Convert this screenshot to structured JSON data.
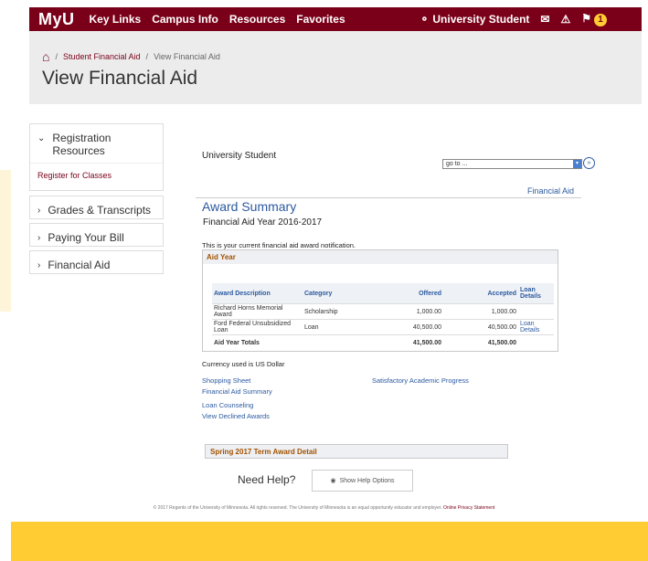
{
  "topnav": {
    "logo": "MyU",
    "items": [
      "Key Links",
      "Campus Info",
      "Resources",
      "Favorites"
    ],
    "user": "University Student",
    "notification_count": "1"
  },
  "breadcrumb": {
    "link": "Student Financial Aid",
    "current": "View Financial Aid"
  },
  "page_title": "View Financial Aid",
  "sidebar": {
    "registration": {
      "label": "Registration Resources",
      "link": "Register for Classes"
    },
    "items": [
      "Grades & Transcripts",
      "Paying Your Bill",
      "Financial Aid"
    ]
  },
  "main": {
    "student_name": "University Student",
    "goto_placeholder": "go to ...",
    "financial_aid_link": "Financial Aid",
    "award_summary_title": "Award Summary",
    "aid_year_label": "Financial Aid Year 2016-2017",
    "notification_text": "This is your current financial aid award notification.",
    "aid_year_header": "Aid Year",
    "table_headers": [
      "Award Description",
      "Category",
      "Offered",
      "Accepted",
      "Loan Details"
    ],
    "rows": [
      {
        "desc": "Richard Horns Memorial Award",
        "category": "Scholarship",
        "offered": "1,000.00",
        "accepted": "1,000.00",
        "loan": ""
      },
      {
        "desc": "Ford Federal Unsubsidized Loan",
        "category": "Loan",
        "offered": "40,500.00",
        "accepted": "40,500.00",
        "loan": "Loan Details"
      }
    ],
    "totals": {
      "label": "Aid Year Totals",
      "offered": "41,500.00",
      "accepted": "41,500.00"
    },
    "currency_note": "Currency used is US Dollar",
    "links": {
      "shopping_sheet": "Shopping Sheet",
      "fa_summary": "Financial Aid Summary",
      "sap": "Satisfactory Academic Progress",
      "loan_counseling": "Loan Counseling",
      "declined_awards": "View Declined Awards"
    },
    "term_header": "Spring 2017 Term Award Detail"
  },
  "help": {
    "title": "Need Help?",
    "button": "Show Help Options"
  },
  "footer": {
    "text": "© 2017 Regents of the University of Minnesota. All rights reserved. The University of Minnesota is an equal opportunity educator and employer.",
    "privacy": "Online Privacy Statement"
  }
}
